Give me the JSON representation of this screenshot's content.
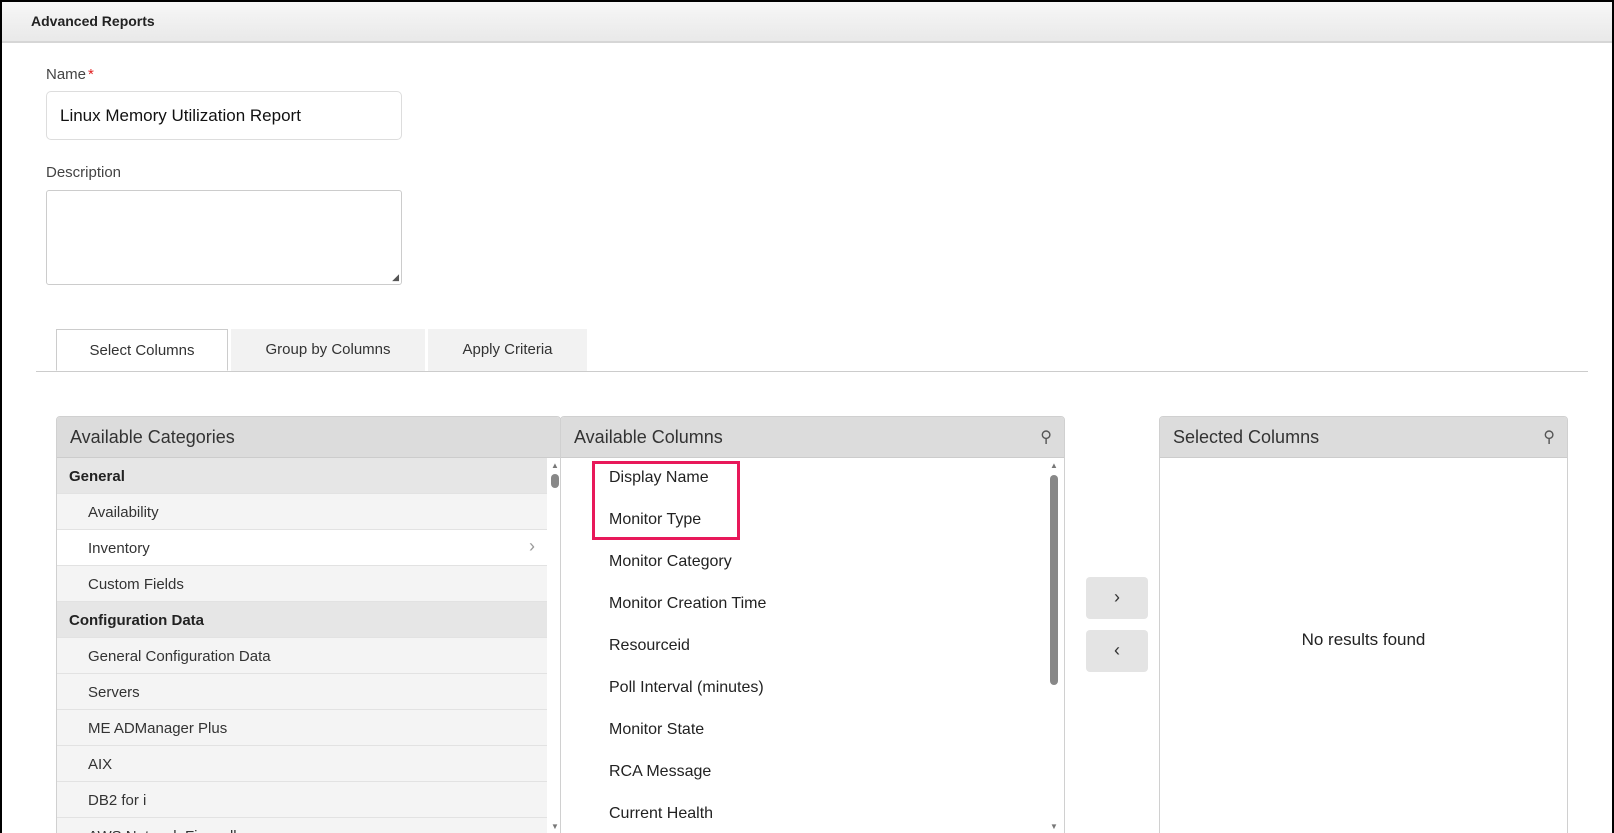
{
  "header": {
    "title": "Advanced Reports"
  },
  "form": {
    "name_label": "Name",
    "required_mark": "*",
    "name_value": "Linux Memory Utilization Report",
    "description_label": "Description",
    "description_value": ""
  },
  "tabs": [
    {
      "label": "Select Columns",
      "active": true
    },
    {
      "label": "Group by Columns"
    },
    {
      "label": "Apply Criteria"
    }
  ],
  "categories": {
    "title": "Available Categories",
    "items": [
      {
        "label": "General",
        "type": "header"
      },
      {
        "label": "Availability"
      },
      {
        "label": "Inventory",
        "selected": true
      },
      {
        "label": "Custom Fields"
      },
      {
        "label": "Configuration Data",
        "type": "header"
      },
      {
        "label": "General Configuration Data"
      },
      {
        "label": "Servers"
      },
      {
        "label": "ME ADManager Plus"
      },
      {
        "label": "AIX"
      },
      {
        "label": "DB2 for i"
      },
      {
        "label": "AWS Network Firewall"
      }
    ]
  },
  "columns": {
    "title": "Available Columns",
    "items": [
      "Display Name",
      "Monitor Type",
      "Monitor Category",
      "Monitor Creation Time",
      "Resourceid",
      "Poll Interval (minutes)",
      "Monitor State",
      "RCA Message",
      "Current Health"
    ]
  },
  "buttons": {
    "add": "›",
    "remove": "‹"
  },
  "selected": {
    "title": "Selected Columns",
    "empty": "No results found"
  },
  "colors": {
    "highlight": "#e8185a",
    "required": "#e02020"
  }
}
